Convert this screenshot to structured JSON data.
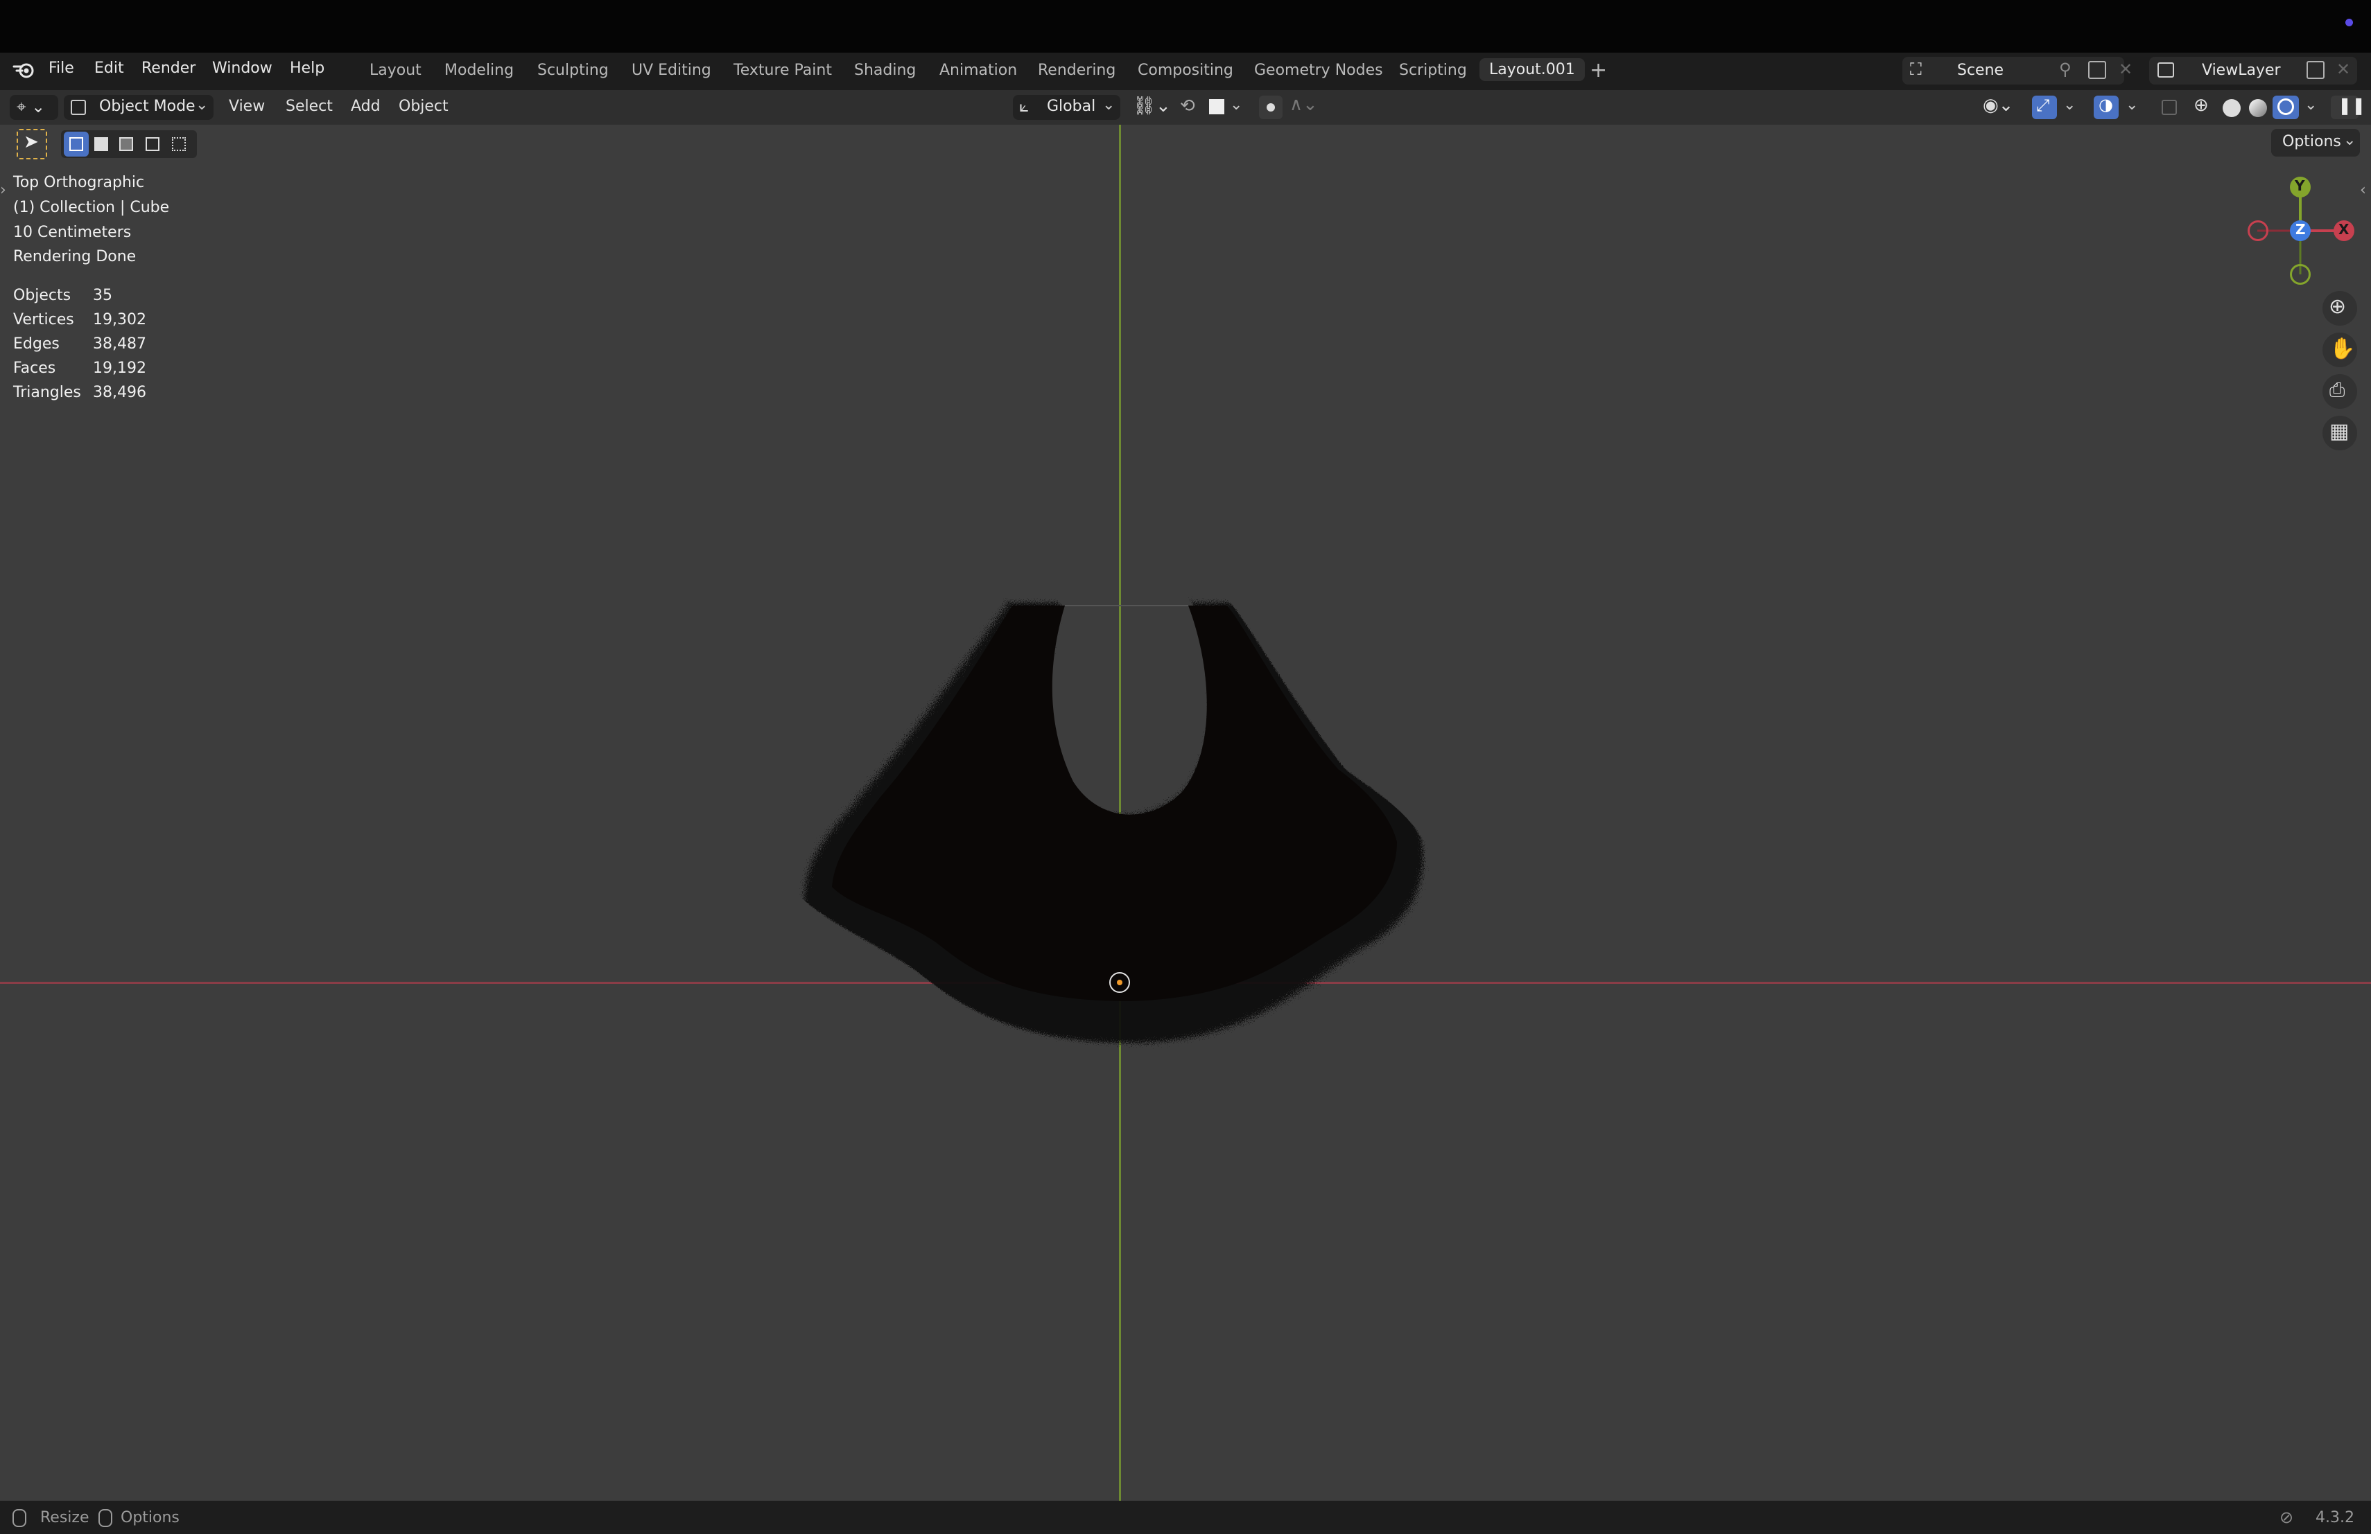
{
  "menus": [
    "File",
    "Edit",
    "Render",
    "Window",
    "Help"
  ],
  "workspaces": [
    "Layout",
    "Modeling",
    "Sculpting",
    "UV Editing",
    "Texture Paint",
    "Shading",
    "Animation",
    "Rendering",
    "Compositing",
    "Geometry Nodes",
    "Scripting"
  ],
  "active_workspace": "Layout.001",
  "scene": {
    "name": "Scene"
  },
  "view_layer": {
    "name": "ViewLayer"
  },
  "viewport_header": {
    "mode": "Object Mode",
    "menus": [
      "View",
      "Select",
      "Add",
      "Object"
    ],
    "orientation": "Global",
    "options": "Options"
  },
  "overlay": {
    "view": "Top Orthographic",
    "collection": "(1) Collection | Cube",
    "scale": "10 Centimeters",
    "status": "Rendering Done",
    "stats": [
      {
        "label": "Objects",
        "value": "35"
      },
      {
        "label": "Vertices",
        "value": "19,302"
      },
      {
        "label": "Edges",
        "value": "38,487"
      },
      {
        "label": "Faces",
        "value": "19,192"
      },
      {
        "label": "Triangles",
        "value": "38,496"
      }
    ]
  },
  "gizmo": {
    "x": "X",
    "y": "Y",
    "z": "Z"
  },
  "statusbar": {
    "resize": "Resize",
    "options": "Options",
    "version": "4.3.2"
  },
  "colors": {
    "axis_x": "#c7404f",
    "axis_y": "#84a52c",
    "axis_z": "#3f7be0",
    "active_blue": "#4a72c4",
    "origin": "#f09a2a"
  }
}
